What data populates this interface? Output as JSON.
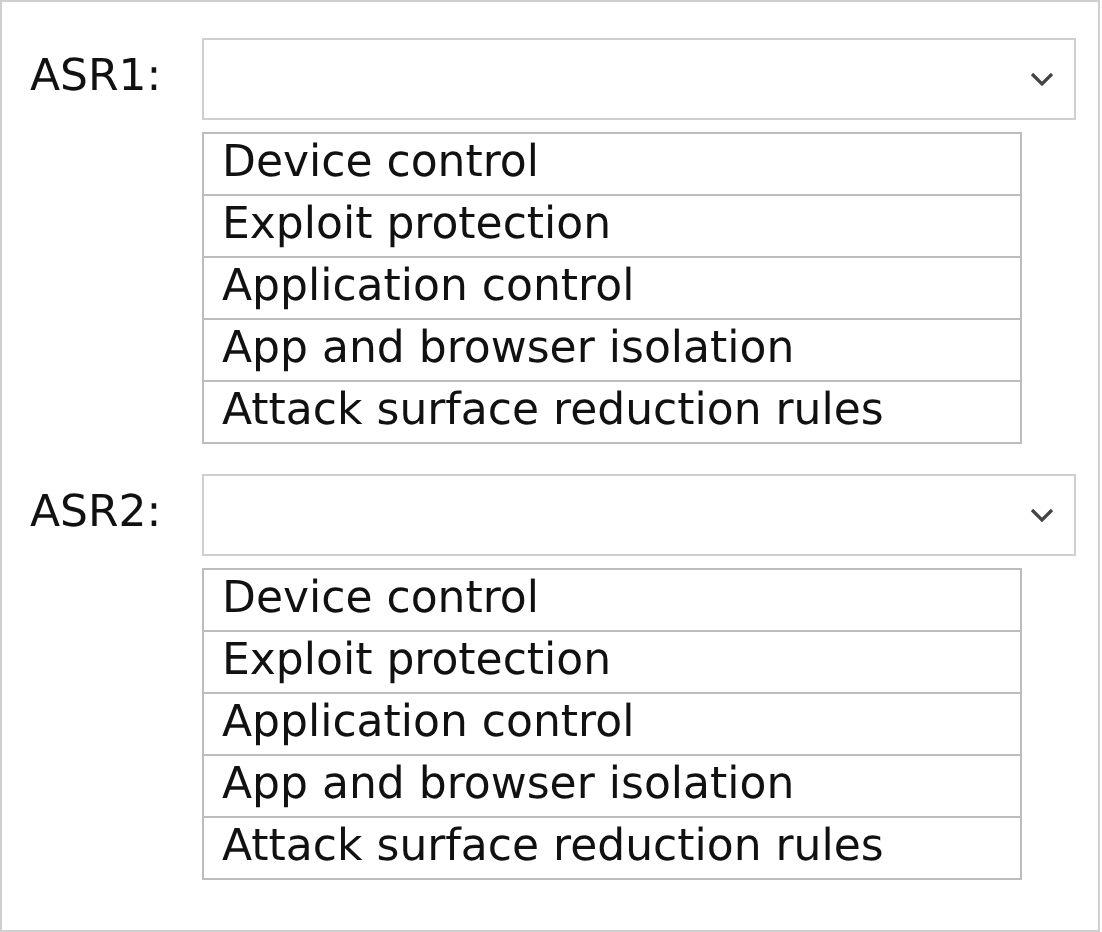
{
  "dropdowns": [
    {
      "label": "ASR1:",
      "options": [
        "Device control",
        "Exploit protection",
        "Application control",
        "App and browser isolation",
        "Attack surface reduction rules"
      ]
    },
    {
      "label": "ASR2:",
      "options": [
        "Device control",
        "Exploit protection",
        "Application control",
        "App and browser isolation",
        "Attack surface reduction rules"
      ]
    }
  ]
}
